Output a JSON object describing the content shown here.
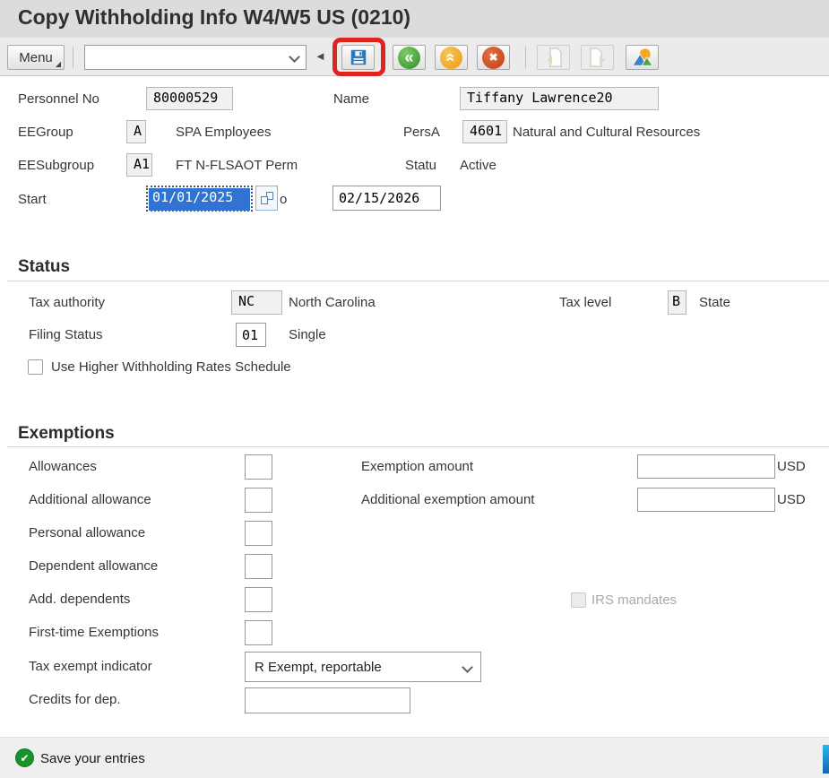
{
  "window": {
    "title": "Copy Withholding Info W4/W5 US (0210)"
  },
  "toolbar": {
    "menu_label": "Menu",
    "menu_corner_glyph": "◢",
    "command_field_value": "",
    "collapse_glyph": "◄",
    "back_glyph": "«",
    "cancel_glyph": "✖",
    "icons": [
      "save-icon",
      "back-icon",
      "exit-icon",
      "cancel-icon",
      "previous-record-icon",
      "next-record-icon",
      "overview-icon"
    ]
  },
  "header": {
    "personnel_no": {
      "label": "Personnel No",
      "value": "80000529"
    },
    "name": {
      "label": "Name",
      "value": "Tiffany Lawrence20"
    },
    "ee_group": {
      "label": "EEGroup",
      "code": "A",
      "text": "SPA Employees"
    },
    "pers_area": {
      "label": "PersA",
      "code": "4601",
      "text": "Natural and Cultural Resources"
    },
    "ee_subgroup": {
      "label": "EESubgroup",
      "code": "A1",
      "text": "FT N-FLSAOT Perm"
    },
    "emp_status": {
      "label": "Statu",
      "text": "Active"
    },
    "validity": {
      "label": "Start",
      "from": "01/01/2025",
      "to_suffix": "o",
      "to": "02/15/2026"
    }
  },
  "status_section": {
    "heading": "Status",
    "tax_authority": {
      "label": "Tax authority",
      "code": "NC",
      "text": "North Carolina"
    },
    "tax_level": {
      "label": "Tax level",
      "code": "B",
      "text": "State"
    },
    "filing_status": {
      "label": "Filing Status",
      "code": "01",
      "text": "Single"
    },
    "higher_withholding": {
      "label": "Use Higher Withholding Rates Schedule",
      "checked": false
    }
  },
  "exemptions_section": {
    "heading": "Exemptions",
    "allowances": {
      "label": "Allowances",
      "value": ""
    },
    "additional_allowance": {
      "label": "Additional allowance",
      "value": ""
    },
    "personal_allowance": {
      "label": "Personal allowance",
      "value": ""
    },
    "dependent_allowance": {
      "label": "Dependent allowance",
      "value": ""
    },
    "add_dependents": {
      "label": "Add. dependents",
      "value": ""
    },
    "first_time_exemptions": {
      "label": "First-time Exemptions",
      "value": ""
    },
    "tax_exempt_indicator": {
      "label": "Tax exempt indicator",
      "selected": "R Exempt, reportable"
    },
    "credits_for_dep": {
      "label": "Credits for dep.",
      "value": ""
    },
    "exemption_amount": {
      "label": "Exemption amount",
      "value": "",
      "currency": "USD"
    },
    "additional_exemption_amount": {
      "label": "Additional exemption amount",
      "value": "",
      "currency": "USD"
    },
    "irs_mandates": {
      "label": "IRS mandates",
      "checked": false,
      "disabled": true
    }
  },
  "statusbar": {
    "message": "Save your entries",
    "check_glyph": "✔"
  },
  "colors": {
    "save_highlight": "#dd2420",
    "success_green": "#18922b",
    "selection_blue": "#3173d3",
    "title_bg": "#dcdcdc"
  }
}
